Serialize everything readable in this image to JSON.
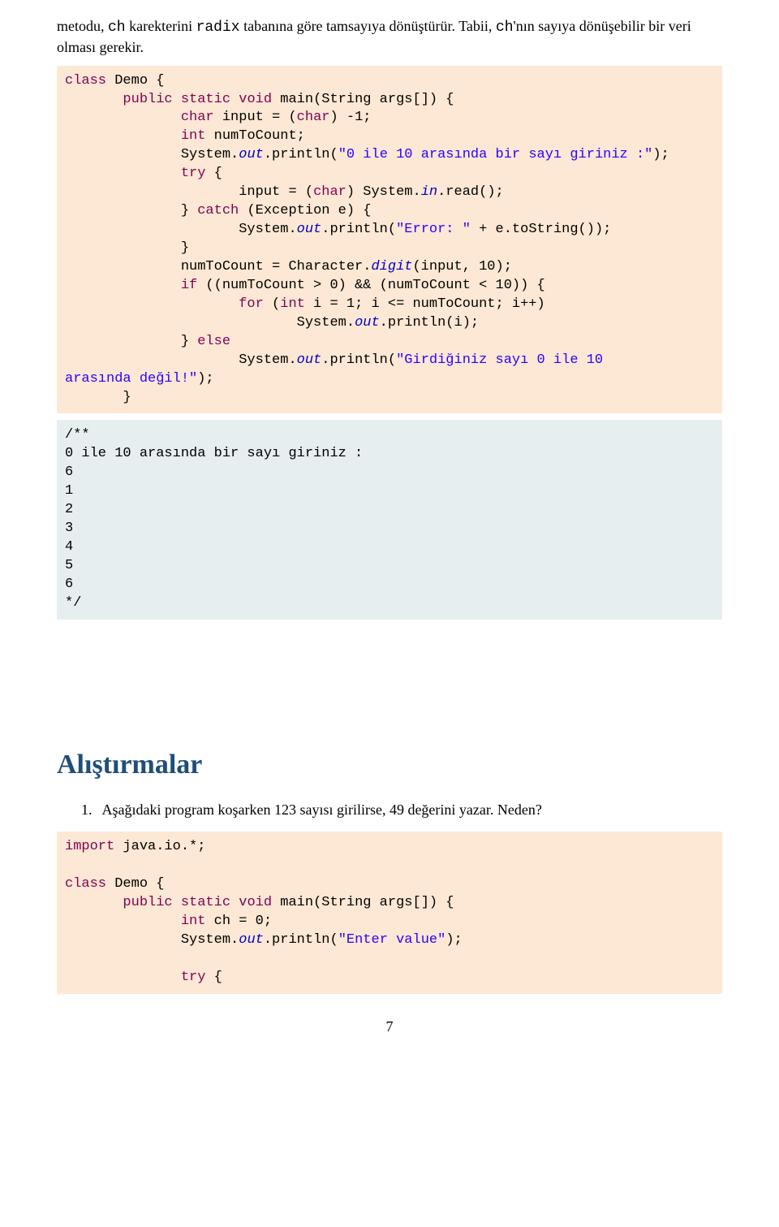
{
  "intro": {
    "p1_pre": "metodu, ",
    "p1_mono1": "ch",
    "p1_mid1": " karekterini ",
    "p1_mono2": "radix",
    "p1_mid2": " tabanına göre tamsayıya dönüştürür. Tabii, ",
    "p1_mono3": "ch",
    "p1_mid3": "'nın sayıya dönüşebilir bir veri olması gerekir."
  },
  "code1": {
    "l1a": "class",
    "l1b": " Demo {",
    "l2a": "       public",
    "l2b": " static",
    "l2c": " void",
    "l2d": " main(String args[]) {",
    "l3a": "              char",
    "l3b": " input = (",
    "l3c": "char",
    "l3d": ") -1;",
    "l4a": "              int",
    "l4b": " numToCount;",
    "l5a": "              System.",
    "l5b": "out",
    "l5c": ".println(",
    "l5d": "\"0 ile 10 arasında bir sayı giriniz :\"",
    "l5e": ");",
    "l6a": "              try",
    "l6b": " {",
    "l7a": "                     input = (",
    "l7b": "char",
    "l7c": ") System.",
    "l7d": "in",
    "l7e": ".read();",
    "l8a": "              } ",
    "l8b": "catch",
    "l8c": " (Exception e) {",
    "l9a": "                     System.",
    "l9b": "out",
    "l9c": ".println(",
    "l9d": "\"Error: \"",
    "l9e": " + e.toString());",
    "l10": "              }",
    "l11a": "              numToCount = Character.",
    "l11b": "digit",
    "l11c": "(input, 10);",
    "l12a": "              if",
    "l12b": " ((numToCount > 0) && (numToCount < 10)) {",
    "l13a": "                     for",
    "l13b": " (",
    "l13c": "int",
    "l13d": " i = 1; i <= numToCount; i++)",
    "l14a": "                            System.",
    "l14b": "out",
    "l14c": ".println(i);",
    "l15a": "              } ",
    "l15b": "else",
    "l16a": "                     System.",
    "l16b": "out",
    "l16c": ".println(",
    "l16d": "\"Girdiğiniz sayı 0 ile 10",
    "l17a": "arasında değil!\"",
    "l17b": ");",
    "l18": "       }"
  },
  "code2": {
    "l1": "/**",
    "l2": "0 ile 10 arasında bir sayı giriniz :",
    "l3": "6",
    "l4": "1",
    "l5": "2",
    "l6": "3",
    "l7": "4",
    "l8": "5",
    "l9": "6",
    "l10": "*/"
  },
  "heading": "Alıştırmalar",
  "list": {
    "idx1": "1.",
    "item1": "Aşağıdaki program koşarken 123 sayısı girilirse, 49 değerini yazar. Neden?"
  },
  "code3": {
    "l1a": "import",
    "l1b": " java.io.*;",
    "blank": "",
    "l2a": "class",
    "l2b": " Demo {",
    "l3a": "       public",
    "l3b": " static",
    "l3c": " void",
    "l3d": " main(String args[]) {",
    "l4a": "              int",
    "l4b": " ch = 0;",
    "l5a": "              System.",
    "l5b": "out",
    "l5c": ".println(",
    "l5d": "\"Enter value\"",
    "l5e": ");",
    "l6": "",
    "l7a": "              try",
    "l7b": " {"
  },
  "pagenum": "7"
}
